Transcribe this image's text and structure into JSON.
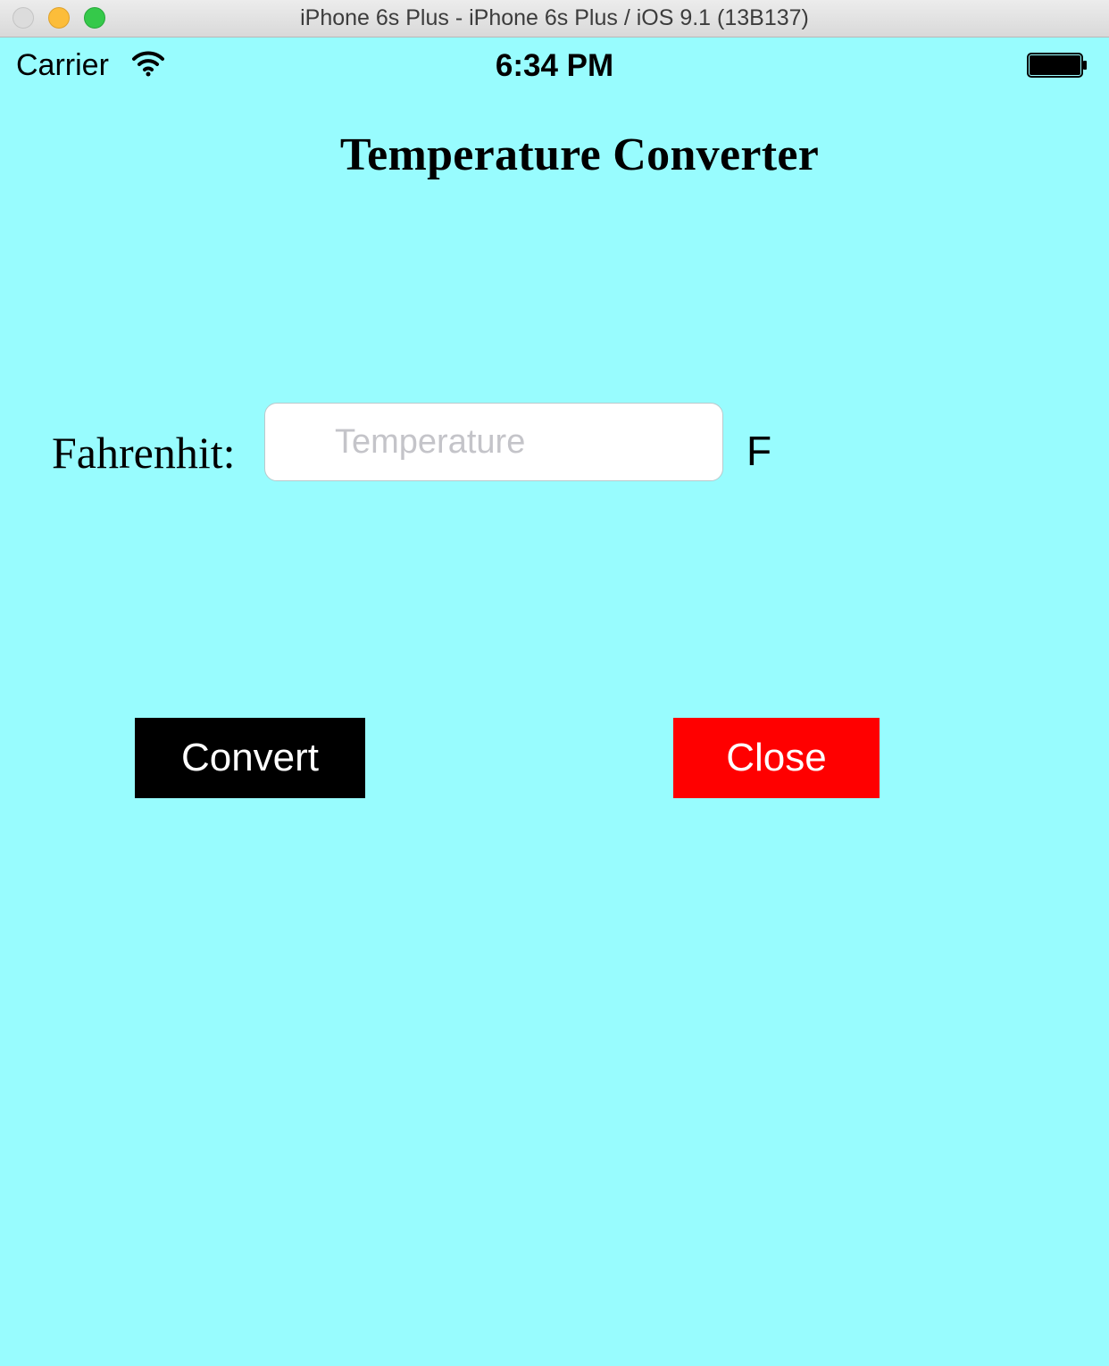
{
  "window": {
    "title": "iPhone 6s Plus - iPhone 6s Plus / iOS 9.1 (13B137)"
  },
  "status_bar": {
    "carrier": "Carrier",
    "time": "6:34 PM",
    "wifi_icon": "wifi-icon",
    "battery_icon": "battery-icon",
    "battery_level": 1.0
  },
  "app": {
    "title": "Temperature Converter",
    "fahrenheit_label": "Fahrenhit:",
    "temperature_input": {
      "value": "",
      "placeholder": "Temperature"
    },
    "unit": "F",
    "convert_button": "Convert",
    "close_button": "Close"
  },
  "colors": {
    "background": "#98fcfe",
    "convert_button": "#000000",
    "close_button": "#ff0000",
    "button_text": "#ffffff"
  }
}
